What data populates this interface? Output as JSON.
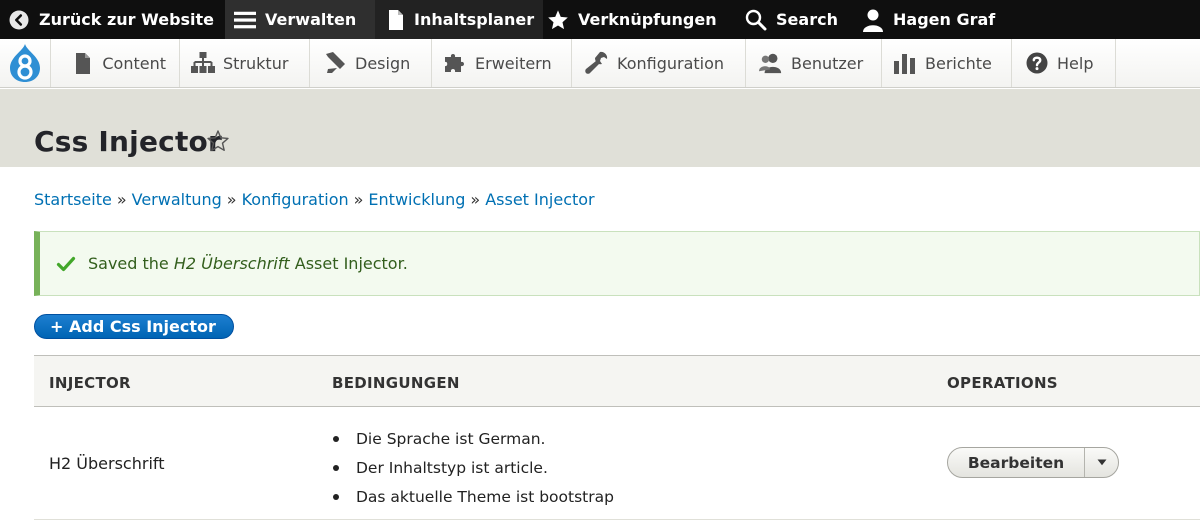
{
  "toolbar": {
    "back_label": "Zurück zur Website",
    "manage_label": "Verwalten",
    "planner_label": "Inhaltsplaner",
    "shortcuts_label": "Verknüpfungen",
    "search_label": "Search",
    "user_label": "Hagen Graf"
  },
  "tray": {
    "items": [
      {
        "label": "Content",
        "icon": "file-icon"
      },
      {
        "label": "Struktur",
        "icon": "sitemap-icon"
      },
      {
        "label": "Design",
        "icon": "paintbrush-icon"
      },
      {
        "label": "Erweitern",
        "icon": "puzzle-icon"
      },
      {
        "label": "Konfiguration",
        "icon": "wrench-icon"
      },
      {
        "label": "Benutzer",
        "icon": "people-icon"
      },
      {
        "label": "Berichte",
        "icon": "bar-chart-icon"
      },
      {
        "label": "Help",
        "icon": "help-icon"
      }
    ]
  },
  "page": {
    "title": "Css Injector"
  },
  "breadcrumb": {
    "items": [
      "Startseite",
      "Verwaltung",
      "Konfiguration",
      "Entwicklung",
      "Asset Injector"
    ],
    "separator": "»"
  },
  "message": {
    "prefix": "Saved the",
    "name": "H2 Überschrift",
    "suffix": "Asset Injector."
  },
  "actions": {
    "add_label": "+ Add Css Injector"
  },
  "table": {
    "headers": [
      "INJECTOR",
      "BEDINGUNGEN",
      "OPERATIONS"
    ],
    "rows": [
      {
        "injector": "H2 Überschrift",
        "conditions": [
          "Die Sprache ist German.",
          "Der Inhaltstyp ist article.",
          "Das aktuelle Theme ist bootstrap"
        ],
        "operation": "Bearbeiten"
      }
    ]
  },
  "colors": {
    "link": "#0070b3",
    "primary_button": "#0064b4",
    "success_border": "#77b259",
    "toolbar_bg": "#0f0f0f"
  }
}
